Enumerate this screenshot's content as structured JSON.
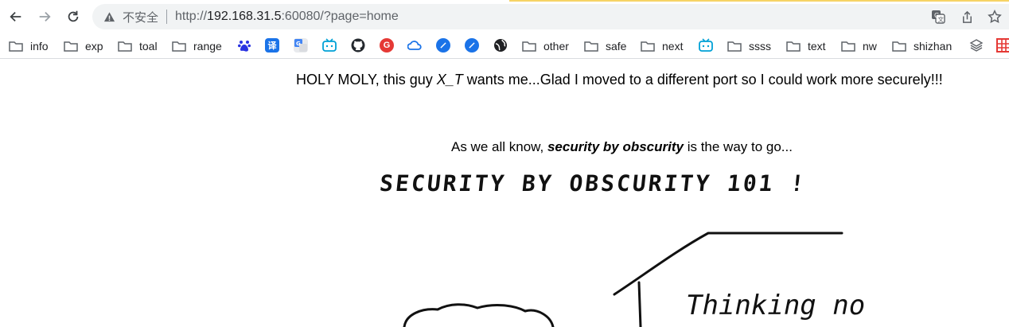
{
  "browser": {
    "security_label": "不安全",
    "url_prefix": "http://",
    "url_host": "192.168.31.5",
    "url_rest": ":60080/?page=home",
    "icons": {
      "back": "back-arrow-icon",
      "forward": "forward-arrow-icon",
      "reload": "reload-icon",
      "warning": "warning-triangle-icon",
      "translate": "translate-icon",
      "share": "share-icon",
      "bookmark_star": "star-icon"
    }
  },
  "bookmarks": [
    {
      "type": "folder",
      "label": "info"
    },
    {
      "type": "folder",
      "label": "exp"
    },
    {
      "type": "folder",
      "label": "toal"
    },
    {
      "type": "folder",
      "label": "range"
    },
    {
      "type": "icon",
      "icon": "baidu-paw-icon"
    },
    {
      "type": "icon",
      "icon": "translate-yi-icon",
      "glyph": "译"
    },
    {
      "type": "icon",
      "icon": "google-translate-icon"
    },
    {
      "type": "icon",
      "icon": "bilibili-icon"
    },
    {
      "type": "icon",
      "icon": "github-icon"
    },
    {
      "type": "icon",
      "icon": "g-red-icon",
      "glyph": "G"
    },
    {
      "type": "icon",
      "icon": "cloud-icon"
    },
    {
      "type": "icon",
      "icon": "compass-icon"
    },
    {
      "type": "icon",
      "icon": "compass-icon-2"
    },
    {
      "type": "icon",
      "icon": "globe-icon"
    },
    {
      "type": "folder",
      "label": "other"
    },
    {
      "type": "folder",
      "label": "safe"
    },
    {
      "type": "folder",
      "label": "next"
    },
    {
      "type": "icon",
      "icon": "bilibili-icon-2"
    },
    {
      "type": "folder",
      "label": "ssss"
    },
    {
      "type": "folder",
      "label": "text"
    },
    {
      "type": "folder",
      "label": "nw"
    },
    {
      "type": "folder",
      "label": "shizhan"
    },
    {
      "type": "icon",
      "icon": "layers-icon"
    },
    {
      "type": "icon",
      "icon": "grid-red-icon"
    }
  ],
  "page": {
    "headline_before": "HOLY MOLY, this guy ",
    "headline_em": "X_T",
    "headline_after": " wants me...Glad I moved to a different port so I could work more securely!!!",
    "subline_before": "As we all know, ",
    "subline_bold": "security by obscurity",
    "subline_after": " is the way to go...",
    "sketch_title": "SECURITY BY OBSCURITY 101 !",
    "sketch_note": "Thinking no"
  },
  "colors": {
    "accent_bar": "#f6d365",
    "omnibox_bg": "#f1f3f4",
    "github": "#24292e",
    "baidu": "#2932e1",
    "blue_icon": "#1a73e8",
    "bilibili": "#00a1d6",
    "red_g": "#e53935"
  }
}
